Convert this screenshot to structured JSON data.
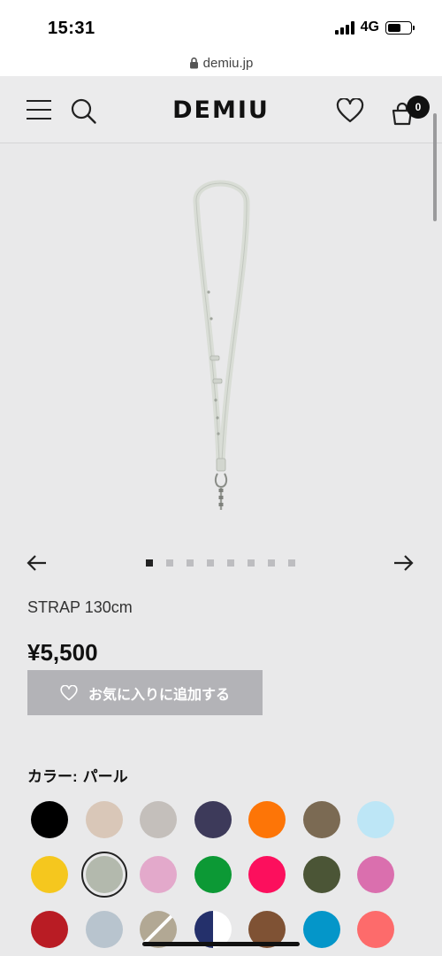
{
  "status_bar": {
    "time": "15:31",
    "network": "4G"
  },
  "browser": {
    "url": "demiu.jp"
  },
  "header": {
    "brand": "DEMIU",
    "cart_count": "0"
  },
  "gallery": {
    "total_slides": 8,
    "active_slide": 1
  },
  "product": {
    "title": "STRAP 130cm",
    "price": "¥5,500",
    "favorite_label": "お気に入りに追加する"
  },
  "color": {
    "label": "カラー:",
    "selected_name": "パール"
  },
  "swatches": [
    [
      "#000000",
      "#d9c7b8",
      "#c4bfbb",
      "#3d3a5a",
      "#fd7507",
      "#7b6a53",
      "#bde6f6"
    ],
    [
      "#f5c71e",
      "#b3b9ad",
      "#e3a9cb",
      "#0c9935",
      "#fc0f5d",
      "#4b5536",
      "#da6fae"
    ],
    [
      "#b91c24",
      "#b8c4ce",
      "half:#b2a894:#b2a894",
      "half:#24306b:#ffffff",
      "#7f5234",
      "#0496c9",
      "#fd6b6b"
    ]
  ],
  "selected_swatch": "#b3b9ad"
}
